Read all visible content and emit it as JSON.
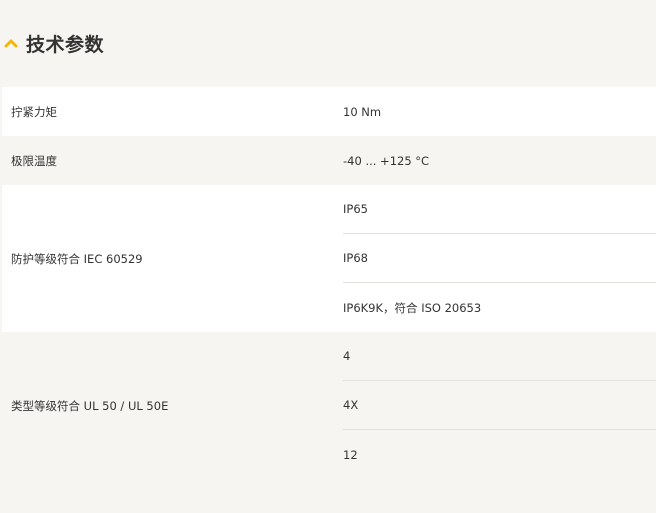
{
  "section": {
    "title": "技术参数",
    "icon": "chevron-up-icon",
    "accent_color": "#f2b705"
  },
  "specs": [
    {
      "label": "拧紧力矩",
      "values": [
        "10 Nm"
      ]
    },
    {
      "label": "极限温度",
      "values": [
        "-40 ... +125 °C"
      ]
    },
    {
      "label": "防护等级符合 IEC 60529",
      "values": [
        "IP65",
        "IP68",
        "IP6K9K，符合 ISO 20653"
      ]
    },
    {
      "label": "类型等级符合 UL 50 / UL 50E",
      "values": [
        "4",
        "4X",
        "12"
      ]
    }
  ]
}
